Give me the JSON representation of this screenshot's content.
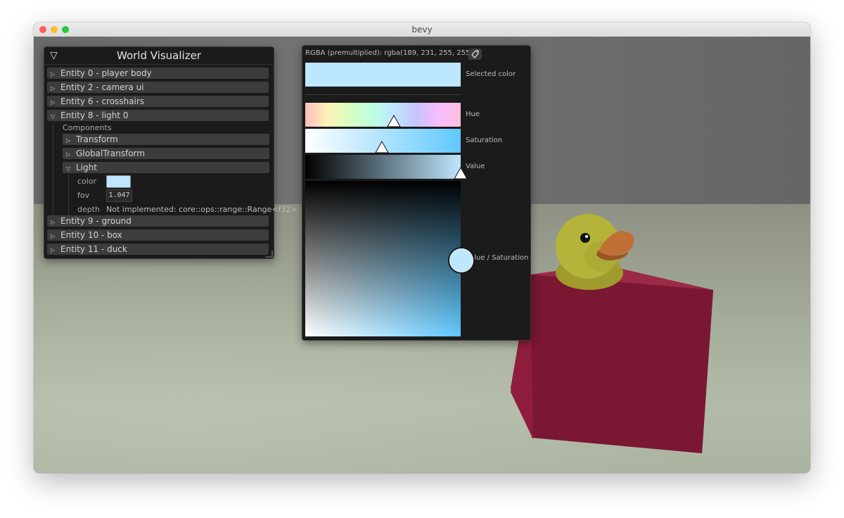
{
  "window": {
    "title": "bevy"
  },
  "world_visualizer": {
    "title": "World Visualizer",
    "collapse_icon": "▽",
    "entities": [
      {
        "label": "Entity 0 - player body",
        "expanded": false
      },
      {
        "label": "Entity 2 - camera ui",
        "expanded": false
      },
      {
        "label": "Entity 6 - crosshairs",
        "expanded": false
      },
      {
        "label": "Entity 8 - light 0",
        "expanded": true
      },
      {
        "label": "Entity 9 - ground",
        "expanded": false
      },
      {
        "label": "Entity 10 - box",
        "expanded": false
      },
      {
        "label": "Entity 11 - duck",
        "expanded": false
      }
    ],
    "components_label": "Components",
    "components": [
      {
        "label": "Transform",
        "expanded": false
      },
      {
        "label": "GlobalTransform",
        "expanded": false
      },
      {
        "label": "Light",
        "expanded": true
      }
    ],
    "light_fields": {
      "color_label": "color",
      "color_value": "#bde7ff",
      "fov_label": "fov",
      "fov_value": "1.047",
      "depth_label": "depth",
      "depth_value": "Not implemented: core::ops::range::Range<f32>"
    },
    "collapsed_icon": "▷",
    "expanded_icon": "▽"
  },
  "color_picker": {
    "rgba_text": "RGBA (premultiplied): rgba(189, 231, 255, 255)",
    "copy_icon": "tag-icon",
    "selected_label": "Selected color",
    "hue_label": "Hue",
    "saturation_label": "Saturation",
    "value_label": "Value",
    "value_saturation_label": "Value / Saturation",
    "selected_color": "#bde7ff",
    "hue_position": 0.57,
    "saturation_position": 0.49,
    "value_position": 1.0
  },
  "scene_colors": {
    "box": "#8c1f40",
    "duck": "#b7b73c",
    "beak": "#c07035"
  }
}
